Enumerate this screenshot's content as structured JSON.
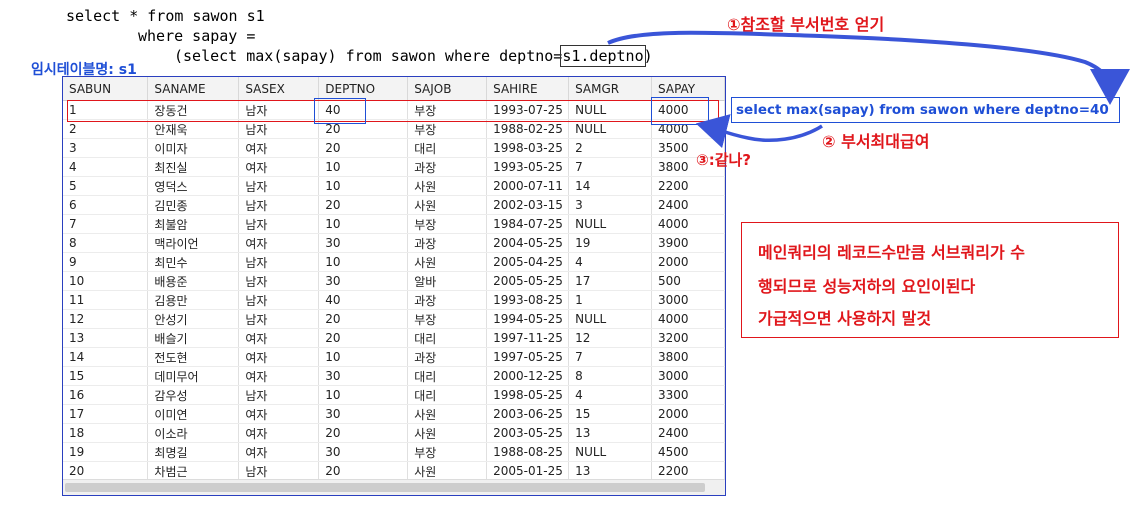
{
  "sql": {
    "line1": "select * from sawon s1",
    "line2": "where sapay =",
    "line3_prefix": "(select max(sapay) from sawon where deptno=",
    "line3_highlight": "s1.deptno",
    "line3_suffix": ")"
  },
  "temp_table_label": "임시테이블명: s1",
  "annotations": {
    "step1": "①참조할 부서번호 얻기",
    "step2": "② 부서최대급여",
    "step3": "③:같나?",
    "subquery": "select max(sapay) from sawon where deptno=40"
  },
  "note": {
    "line1": "메인쿼리의 레코드수만큼 서브쿼리가 수",
    "line2": "행되므로 성능저하의 요인이된다",
    "line3": "가급적으면 사용하지 말것"
  },
  "colors": {
    "accent_blue": "#1f4fd6",
    "accent_red": "#e0161b"
  },
  "table": {
    "columns": [
      "SABUN",
      "SANAME",
      "SASEX",
      "DEPTNO",
      "SAJOB",
      "SAHIRE",
      "SAMGR",
      "SAPAY"
    ],
    "rows": [
      [
        "1",
        "장동건",
        "남자",
        "40",
        "부장",
        "1993-07-25",
        "NULL",
        "4000"
      ],
      [
        "2",
        "안재욱",
        "남자",
        "20",
        "부장",
        "1988-02-25",
        "NULL",
        "4000"
      ],
      [
        "3",
        "이미자",
        "여자",
        "20",
        "대리",
        "1998-03-25",
        "2",
        "3500"
      ],
      [
        "4",
        "최진실",
        "여자",
        "10",
        "과장",
        "1993-05-25",
        "7",
        "3800"
      ],
      [
        "5",
        "영덕스",
        "남자",
        "10",
        "사원",
        "2000-07-11",
        "14",
        "2200"
      ],
      [
        "6",
        "김민종",
        "남자",
        "20",
        "사원",
        "2002-03-15",
        "3",
        "2400"
      ],
      [
        "7",
        "최불암",
        "남자",
        "10",
        "부장",
        "1984-07-25",
        "NULL",
        "4000"
      ],
      [
        "8",
        "맥라이언",
        "여자",
        "30",
        "과장",
        "2004-05-25",
        "19",
        "3900"
      ],
      [
        "9",
        "최민수",
        "남자",
        "10",
        "사원",
        "2005-04-25",
        "4",
        "2000"
      ],
      [
        "10",
        "배용준",
        "남자",
        "30",
        "알바",
        "2005-05-25",
        "17",
        "500"
      ],
      [
        "11",
        "김용만",
        "남자",
        "40",
        "과장",
        "1993-08-25",
        "1",
        "3000"
      ],
      [
        "12",
        "안성기",
        "남자",
        "20",
        "부장",
        "1994-05-25",
        "NULL",
        "4000"
      ],
      [
        "13",
        "배슬기",
        "여자",
        "20",
        "대리",
        "1997-11-25",
        "12",
        "3200"
      ],
      [
        "14",
        "전도현",
        "여자",
        "10",
        "과장",
        "1997-05-25",
        "7",
        "3800"
      ],
      [
        "15",
        "데미무어",
        "여자",
        "30",
        "대리",
        "2000-12-25",
        "8",
        "3000"
      ],
      [
        "16",
        "감우성",
        "남자",
        "10",
        "대리",
        "1998-05-25",
        "4",
        "3300"
      ],
      [
        "17",
        "이미연",
        "여자",
        "30",
        "사원",
        "2003-06-25",
        "15",
        "2000"
      ],
      [
        "18",
        "이소라",
        "여자",
        "20",
        "사원",
        "2003-05-25",
        "13",
        "2400"
      ],
      [
        "19",
        "최명길",
        "여자",
        "30",
        "부장",
        "1988-08-25",
        "NULL",
        "4500"
      ],
      [
        "20",
        "차범근",
        "남자",
        "20",
        "사원",
        "2005-01-25",
        "13",
        "2200"
      ]
    ]
  }
}
